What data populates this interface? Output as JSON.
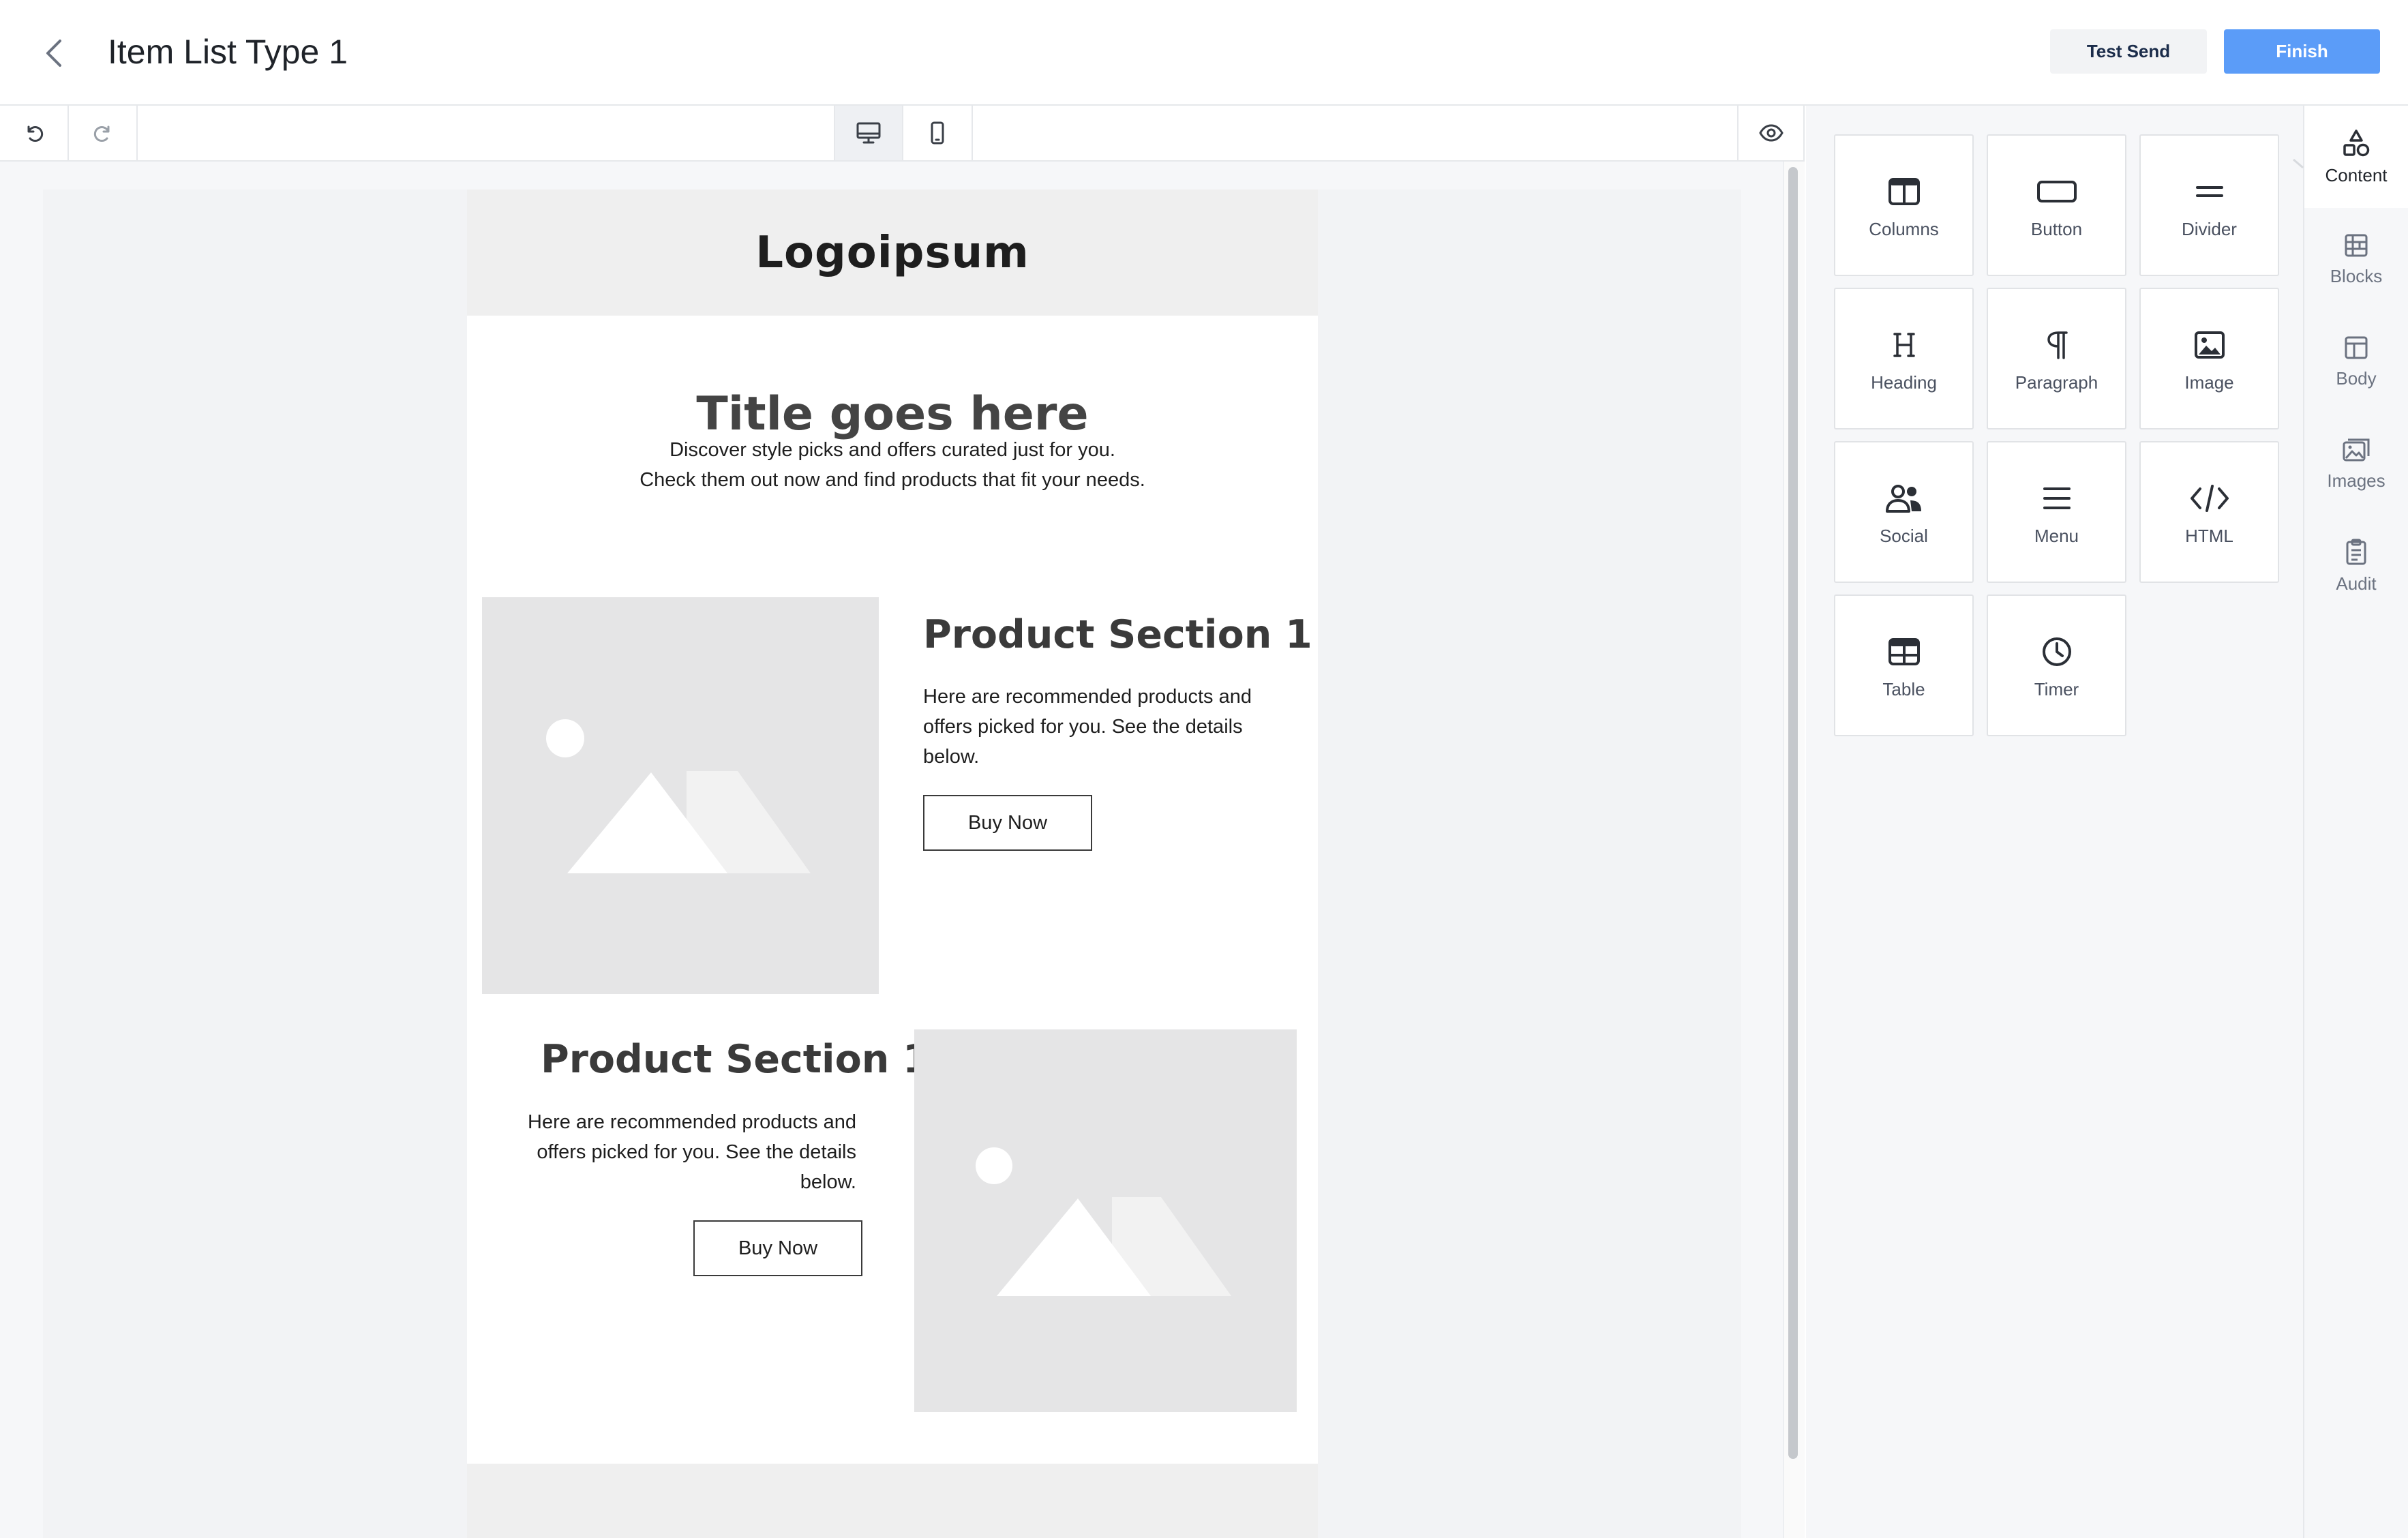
{
  "header": {
    "title": "Item List Type 1",
    "test_send_label": "Test Send",
    "finish_label": "Finish"
  },
  "email": {
    "logo": "Logoipsum",
    "title": "Title goes here",
    "intro": [
      "Discover style picks and offers curated just for you.",
      "Check them out now and find products that fit your needs."
    ],
    "products": [
      {
        "title": "Product Section 1",
        "text": "Here are recommended products and offers picked for you. See the details below.",
        "button": "Buy Now"
      },
      {
        "title": "Product Section 1",
        "text": "Here are recommended products and offers picked for you. See the details below.",
        "button": "Buy Now"
      }
    ]
  },
  "content_tools": [
    {
      "label": "Columns",
      "icon": "columns-icon"
    },
    {
      "label": "Button",
      "icon": "button-icon"
    },
    {
      "label": "Divider",
      "icon": "divider-icon"
    },
    {
      "label": "Heading",
      "icon": "heading-icon"
    },
    {
      "label": "Paragraph",
      "icon": "paragraph-icon"
    },
    {
      "label": "Image",
      "icon": "image-icon"
    },
    {
      "label": "Social",
      "icon": "social-icon"
    },
    {
      "label": "Menu",
      "icon": "menu-icon"
    },
    {
      "label": "HTML",
      "icon": "html-icon"
    },
    {
      "label": "Table",
      "icon": "table-icon"
    },
    {
      "label": "Timer",
      "icon": "timer-icon"
    }
  ],
  "side_nav": [
    {
      "label": "Content",
      "icon": "shapes-icon",
      "active": true
    },
    {
      "label": "Blocks",
      "icon": "blocks-icon",
      "active": false
    },
    {
      "label": "Body",
      "icon": "body-icon",
      "active": false
    },
    {
      "label": "Images",
      "icon": "images-icon",
      "active": false
    },
    {
      "label": "Audit",
      "icon": "audit-icon",
      "active": false
    }
  ],
  "colors": {
    "accent": "#5b9cf8",
    "canvas_bg": "#f2f3f5",
    "placeholder": "#e5e5e6"
  }
}
